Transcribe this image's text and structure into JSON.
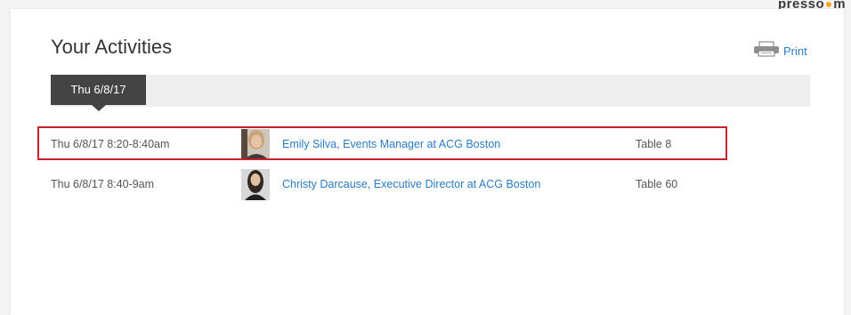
{
  "brand": {
    "fragment_label": "presso",
    "fragment_suffix": "m"
  },
  "page": {
    "title": "Your Activities",
    "print_label": "Print"
  },
  "tabs": [
    {
      "label": "Thu 6/8/17",
      "active": true
    }
  ],
  "activities": [
    {
      "time": "Thu 6/8/17 8:20-8:40am",
      "person": "Emily Silva, Events Manager at ACG Boston",
      "table": "Table 8",
      "highlighted": true
    },
    {
      "time": "Thu 6/8/17 8:40-9am",
      "person": "Christy Darcause, Executive Director at ACG Boston",
      "table": "Table 60",
      "highlighted": false
    }
  ],
  "colors": {
    "link": "#2a7cc7",
    "tab_active_bg": "#444444",
    "highlight_border": "#c8202c",
    "brand_accent": "#f5a623"
  },
  "icons": {
    "print": "printer-icon"
  }
}
